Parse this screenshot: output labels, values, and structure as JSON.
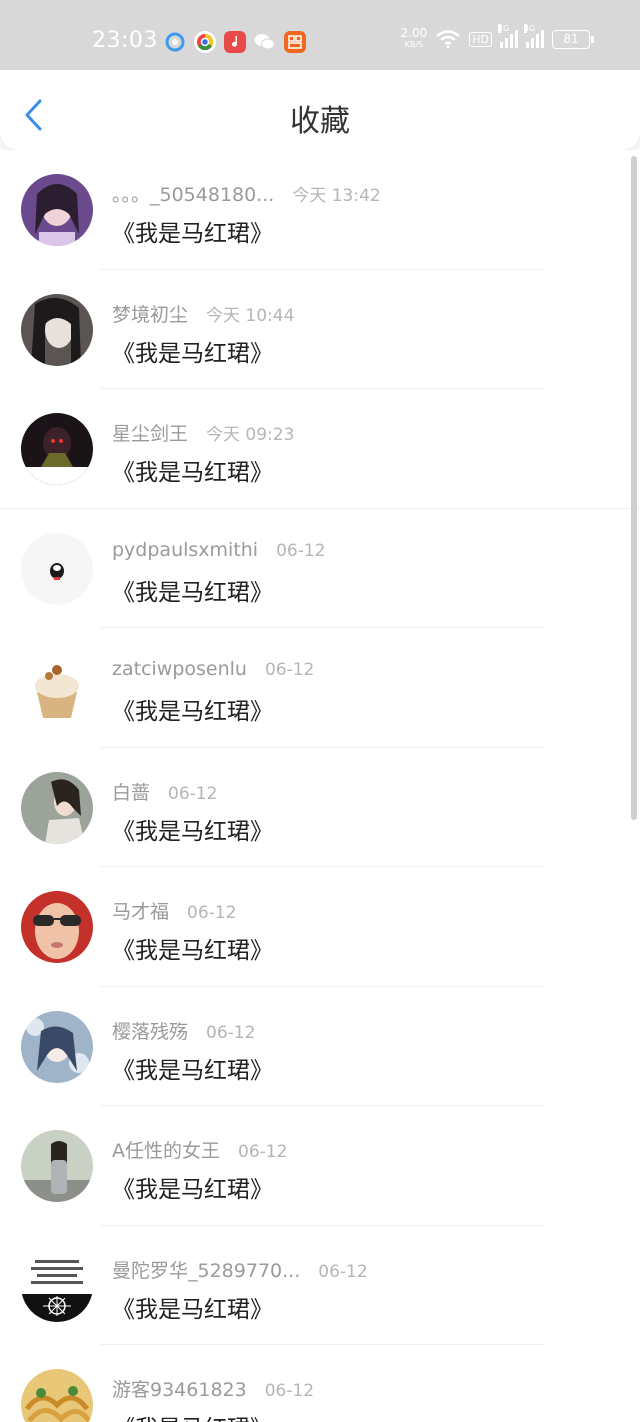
{
  "status_bar": {
    "time": "23:03",
    "speed_value": "2.00",
    "speed_unit": "KB/S",
    "hd": "HD",
    "signal1": "4G",
    "signal2": "4G",
    "battery": "81",
    "app_icons": [
      "browser-icon",
      "chrome-icon",
      "music-icon",
      "wechat-icon",
      "app-icon"
    ]
  },
  "header": {
    "title": "收藏",
    "back_icon": "chevron-left-icon"
  },
  "colors": {
    "accent": "#3a8ee6",
    "background": "#f7f7f7",
    "text": "#222222",
    "muted": "#9a9a9a"
  },
  "items": [
    {
      "user": "。。。_50548180...",
      "time": "今天 13:42",
      "content": "《我是马红珺》",
      "avatar": "avatar-girl-purple"
    },
    {
      "user": "梦境初尘",
      "time": "今天 10:44",
      "content": "《我是马红珺》",
      "avatar": "avatar-anime-man"
    },
    {
      "user": "星尘剑王",
      "time": "今天 09:23",
      "content": "《我是马红珺》",
      "avatar": "avatar-dark-figure"
    },
    {
      "user": "pydpaulsxmithi",
      "time": "06-12",
      "content": "《我是马红珺》",
      "avatar": "avatar-small-mascot"
    },
    {
      "user": "zatciwposenlu",
      "time": "06-12",
      "content": "《我是马红珺》",
      "avatar": "avatar-cupcake"
    },
    {
      "user": "白蔷",
      "time": "06-12",
      "content": "《我是马红珺》",
      "avatar": "avatar-woman"
    },
    {
      "user": "马才福",
      "time": "06-12",
      "content": "《我是马红珺》",
      "avatar": "avatar-sunglasses-man"
    },
    {
      "user": "樱落残殇",
      "time": "06-12",
      "content": "《我是马红珺》",
      "avatar": "avatar-anime-girl"
    },
    {
      "user": "A任性的女王",
      "time": "06-12",
      "content": "《我是马红珺》",
      "avatar": "avatar-woman-street"
    },
    {
      "user": "曼陀罗华_5289770...",
      "time": "06-12",
      "content": "《我是马红珺》",
      "avatar": "avatar-text-flower"
    },
    {
      "user": "游客93461823",
      "time": "06-12",
      "content": "《我是马红珺》",
      "avatar": "avatar-food"
    }
  ]
}
